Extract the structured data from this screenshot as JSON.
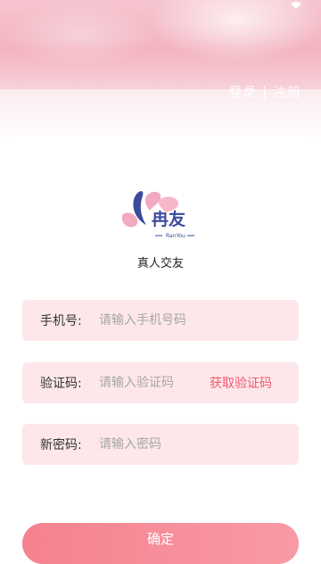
{
  "header": {
    "title_link": "登录 | 注册"
  },
  "brand": {
    "logo_text": "冉友",
    "logo_subtext": "RanYou",
    "tagline": "真人交友",
    "colors": {
      "navy": "#3a4b9b",
      "pink": "#f3a9bf",
      "accent": "#ef5a6e"
    }
  },
  "form": {
    "phone": {
      "label": "手机号:",
      "placeholder": "请输入手机号码"
    },
    "code": {
      "label": "验证码:",
      "placeholder": "请输入验证码",
      "action": "获取验证码"
    },
    "password": {
      "label": "新密码:",
      "placeholder": "请输入密码"
    },
    "submit_label": "确定"
  },
  "icons": {
    "status": "wifi-icon"
  }
}
